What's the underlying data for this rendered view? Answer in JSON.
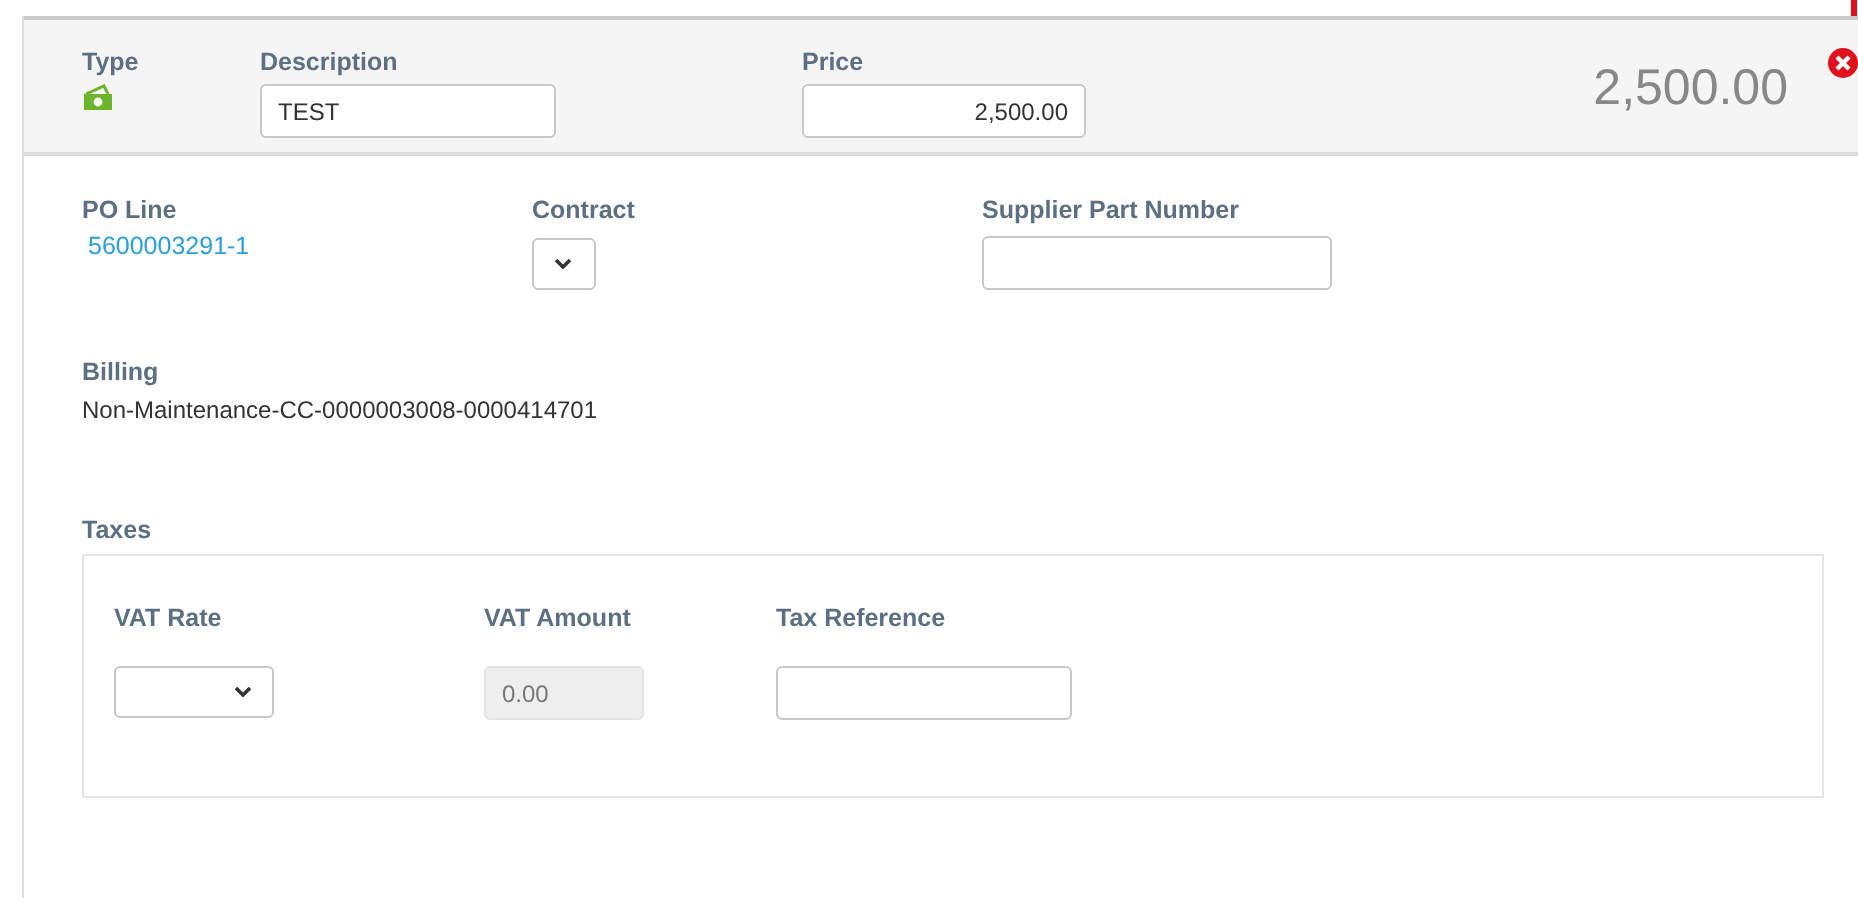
{
  "header": {
    "type": {
      "label": "Type"
    },
    "description": {
      "label": "Description",
      "value": "TEST"
    },
    "price": {
      "label": "Price",
      "value": "2,500.00"
    },
    "total": "2,500.00"
  },
  "details": {
    "po_line": {
      "label": "PO Line",
      "value": "5600003291-1"
    },
    "contract": {
      "label": "Contract"
    },
    "supplier_part_number": {
      "label": "Supplier Part Number"
    },
    "billing": {
      "label": "Billing",
      "value": "Non-Maintenance-CC-0000003008-0000414701"
    }
  },
  "taxes": {
    "label": "Taxes",
    "vat_rate": {
      "label": "VAT Rate"
    },
    "vat_amount": {
      "label": "VAT Amount",
      "value": "0.00",
      "disabled": true
    },
    "tax_reference": {
      "label": "Tax Reference"
    }
  }
}
